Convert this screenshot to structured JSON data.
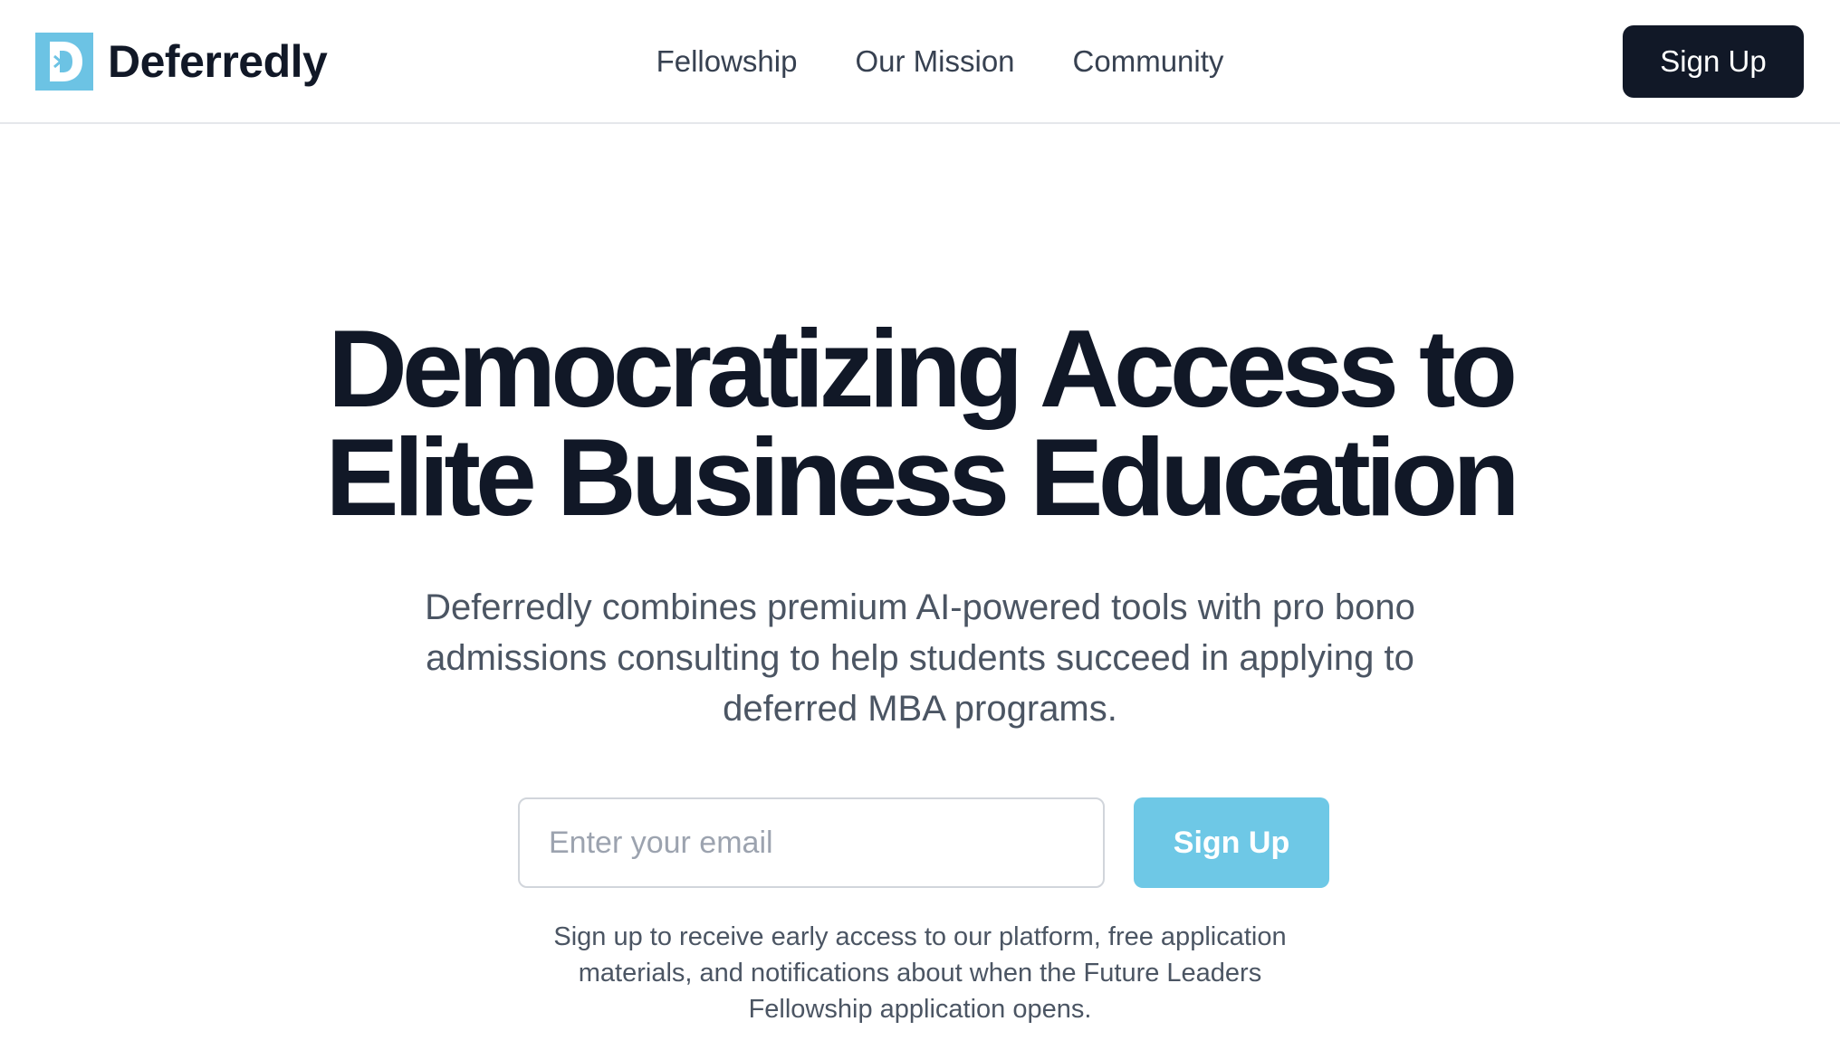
{
  "header": {
    "brand_name": "Deferredly",
    "logo_letter": "D",
    "nav_links": [
      "Fellowship",
      "Our Mission",
      "Community"
    ],
    "signup_label": "Sign Up"
  },
  "hero": {
    "title_line1": "Democratizing Access to",
    "title_line2": "Elite Business Education",
    "subtitle": "Deferredly combines premium AI-powered tools with pro bono admissions consulting to help students succeed in applying to deferred MBA programs.",
    "email_placeholder": "Enter your email",
    "email_value": "",
    "signup_label": "Sign Up",
    "note": "Sign up to receive early access to our platform, free application materials, and notifications about when the Future Leaders Fellowship application opens."
  },
  "colors": {
    "brand_accent": "#6cc3e4",
    "dark": "#111827",
    "muted_text": "#4b5563"
  },
  "icons": {
    "logo": "deferredly-logo-icon"
  }
}
